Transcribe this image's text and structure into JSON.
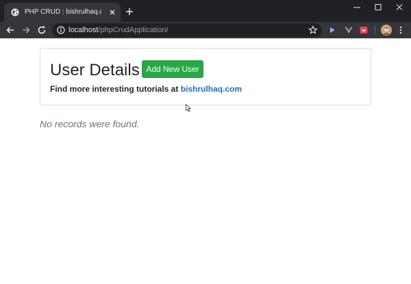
{
  "browser": {
    "tab_title": "PHP CRUD : bishrulhaq.com",
    "url_host": "localhost",
    "url_path": "/phpCrudApplication/",
    "icons": {
      "favicon": "globe-icon",
      "tab_close": "close-icon",
      "new_tab": "plus-icon",
      "minimize": "minimize-icon",
      "maximize": "maximize-icon",
      "close_window": "close-icon",
      "back": "back-arrow-icon",
      "forward": "forward-arrow-icon",
      "reload": "reload-icon",
      "site_info": "info-icon",
      "bookmark": "star-icon",
      "profile": "avatar",
      "menu": "kebab-menu-icon"
    },
    "colors": {
      "tab_strip": "#202124",
      "toolbar": "#35363a"
    }
  },
  "page": {
    "title": "User Details",
    "add_button_label": "Add New User",
    "tagline_prefix": "Find more interesting tutorials at ",
    "tagline_link": "bishrulhaq.com",
    "empty_message": "No records were found.",
    "colors": {
      "add_button": "#28a745",
      "link": "#1a73c8"
    }
  }
}
